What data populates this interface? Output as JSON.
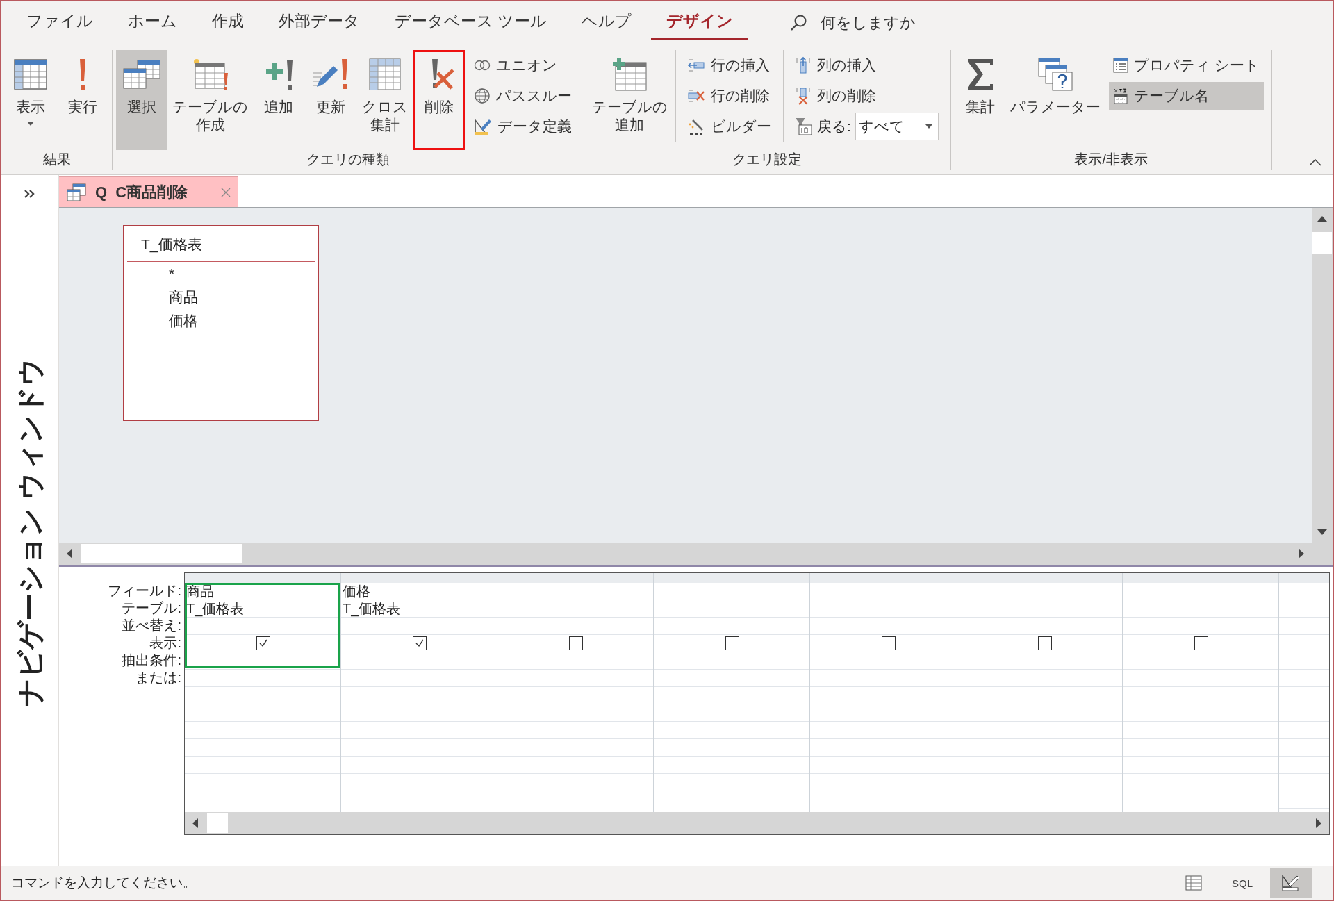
{
  "menu_tabs": [
    {
      "label": "ファイル",
      "selected": false
    },
    {
      "label": "ホーム",
      "selected": false
    },
    {
      "label": "作成",
      "selected": false
    },
    {
      "label": "外部データ",
      "selected": false
    },
    {
      "label": "データベース ツール",
      "selected": false
    },
    {
      "label": "ヘルプ",
      "selected": false
    },
    {
      "label": "デザイン",
      "selected": true
    }
  ],
  "search": {
    "placeholder": "何をしますか"
  },
  "ribbon": {
    "groups": [
      {
        "label": "結果",
        "items": [
          {
            "kind": "large",
            "label": "表示",
            "selected": false,
            "dropdown": true
          },
          {
            "kind": "large",
            "label": "実行",
            "selected": false
          }
        ]
      },
      {
        "label": "クエリの種類",
        "items": [
          {
            "kind": "large",
            "label": "選択",
            "selected": true
          },
          {
            "kind": "large",
            "label": "テーブルの作成",
            "selected": false,
            "two_line": true
          },
          {
            "kind": "large",
            "label": "追加",
            "selected": false
          },
          {
            "kind": "large",
            "label": "更新",
            "selected": false
          },
          {
            "kind": "large",
            "label": "クロス集計",
            "selected": false,
            "two_line": true
          },
          {
            "kind": "large",
            "label": "削除",
            "selected": false,
            "highlighted": true
          },
          {
            "kind": "stack",
            "items": [
              {
                "kind": "small",
                "label": "ユニオン",
                "selected": false
              },
              {
                "kind": "small",
                "label": "パススルー",
                "selected": false
              },
              {
                "kind": "small",
                "label": "データ定義",
                "selected": false
              }
            ]
          }
        ]
      },
      {
        "label": "クエリ設定",
        "items": [
          {
            "kind": "large",
            "label": "テーブルの追加",
            "selected": false,
            "two_line": true
          },
          {
            "kind": "stack",
            "items": [
              {
                "kind": "small",
                "label": "行の挿入",
                "selected": false
              },
              {
                "kind": "small",
                "label": "行の削除",
                "selected": false
              },
              {
                "kind": "small",
                "label": "ビルダー",
                "selected": false
              }
            ]
          },
          {
            "kind": "stack",
            "items": [
              {
                "kind": "small",
                "label": "列の挿入",
                "selected": false
              },
              {
                "kind": "small",
                "label": "列の削除",
                "selected": false
              },
              {
                "kind": "combo",
                "label": "戻る:",
                "value": "すべて"
              }
            ]
          }
        ]
      },
      {
        "label": "表示/非表示",
        "items": [
          {
            "kind": "large",
            "label": "集計",
            "selected": false
          },
          {
            "kind": "large",
            "label": "パラメーター",
            "selected": false
          },
          {
            "kind": "stack",
            "items": [
              {
                "kind": "small",
                "label": "プロパティ シート",
                "selected": false
              },
              {
                "kind": "small",
                "label": "テーブル名",
                "selected": true
              }
            ]
          }
        ]
      }
    ]
  },
  "navigation_pane": {
    "title": "ナビゲーション ウィンドウ"
  },
  "document_tab": {
    "title": "Q_C商品削除"
  },
  "tables": [
    {
      "name": "T_価格表",
      "fields": [
        "*",
        "商品",
        "価格"
      ]
    }
  ],
  "design_grid": {
    "row_labels": [
      "フィールド:",
      "テーブル:",
      "並べ替え:",
      "表示:",
      "抽出条件:",
      "または:"
    ],
    "columns": [
      {
        "field": "商品",
        "table": "T_価格表",
        "show": true,
        "selected": true
      },
      {
        "field": "価格",
        "table": "T_価格表",
        "show": true,
        "selected": false
      },
      {
        "show": false,
        "selected": false
      },
      {
        "show": false,
        "selected": false
      },
      {
        "show": false,
        "selected": false
      },
      {
        "show": false,
        "selected": false
      },
      {
        "show": false,
        "selected": false
      }
    ]
  },
  "status_bar": {
    "text": "コマンドを入力してください。",
    "views": [
      {
        "kind": "datasheet",
        "selected": false
      },
      {
        "kind": "sql",
        "label": "SQL",
        "selected": false
      },
      {
        "kind": "design",
        "selected": true
      }
    ]
  }
}
